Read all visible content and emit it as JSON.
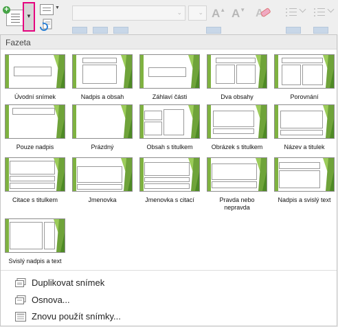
{
  "gallery": {
    "title": "Fazeta",
    "layouts": [
      {
        "label": "Úvodní snímek"
      },
      {
        "label": "Nadpis a obsah"
      },
      {
        "label": "Záhlaví části"
      },
      {
        "label": "Dva obsahy"
      },
      {
        "label": "Porovnání"
      },
      {
        "label": "Pouze nadpis"
      },
      {
        "label": "Prázdný"
      },
      {
        "label": "Obsah s titulkem"
      },
      {
        "label": "Obrázek s titulkem"
      },
      {
        "label": "Název a titulek"
      },
      {
        "label": "Citace s titulkem"
      },
      {
        "label": "Jmenovka"
      },
      {
        "label": "Jmenovka s citací"
      },
      {
        "label": "Pravda nebo nepravda"
      },
      {
        "label": "Nadpis a svislý text"
      },
      {
        "label": "Svislý nadpis a text"
      }
    ]
  },
  "menu": {
    "duplicate": "Duplikovat snímek",
    "outline": "Osnova...",
    "reuse": "Znovu použít snímky..."
  },
  "colors": {
    "accent_green": "#7fb241",
    "highlight": "#e5007e"
  }
}
